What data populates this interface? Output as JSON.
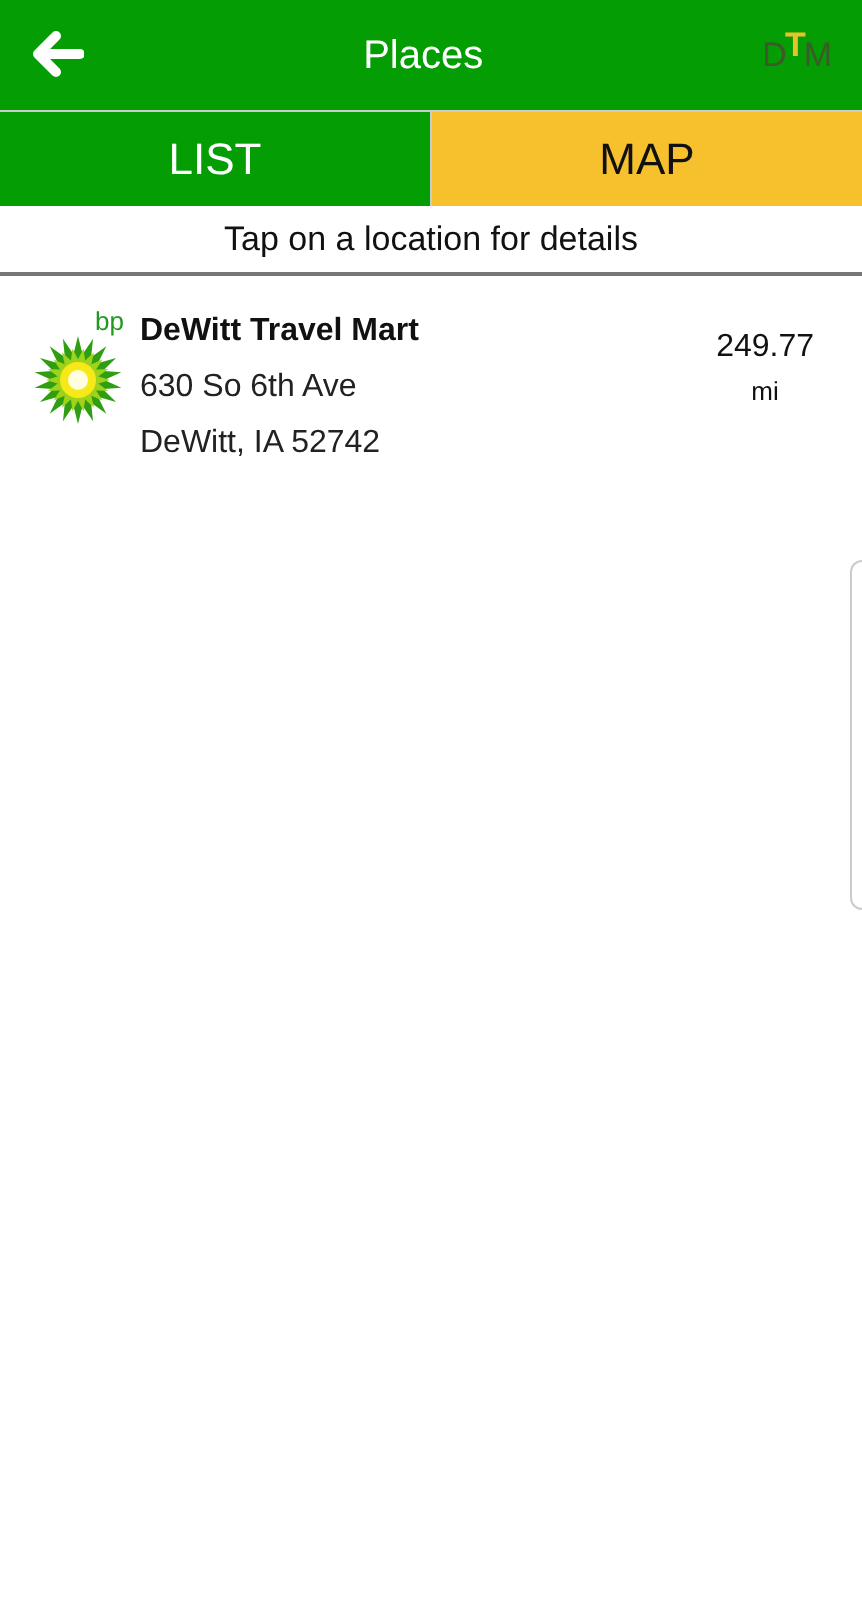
{
  "header": {
    "title": "Places",
    "logo_letters": [
      "D",
      "T",
      "M"
    ]
  },
  "tabs": [
    {
      "label": "LIST",
      "selected": true
    },
    {
      "label": "MAP",
      "selected": false
    }
  ],
  "hint": "Tap on a location for details",
  "places": [
    {
      "brand": "bp",
      "name": "DeWitt Travel Mart",
      "address": "630 So 6th Ave",
      "city": "DeWitt, IA 52742",
      "distance": "249.77",
      "unit": "mi"
    }
  ]
}
